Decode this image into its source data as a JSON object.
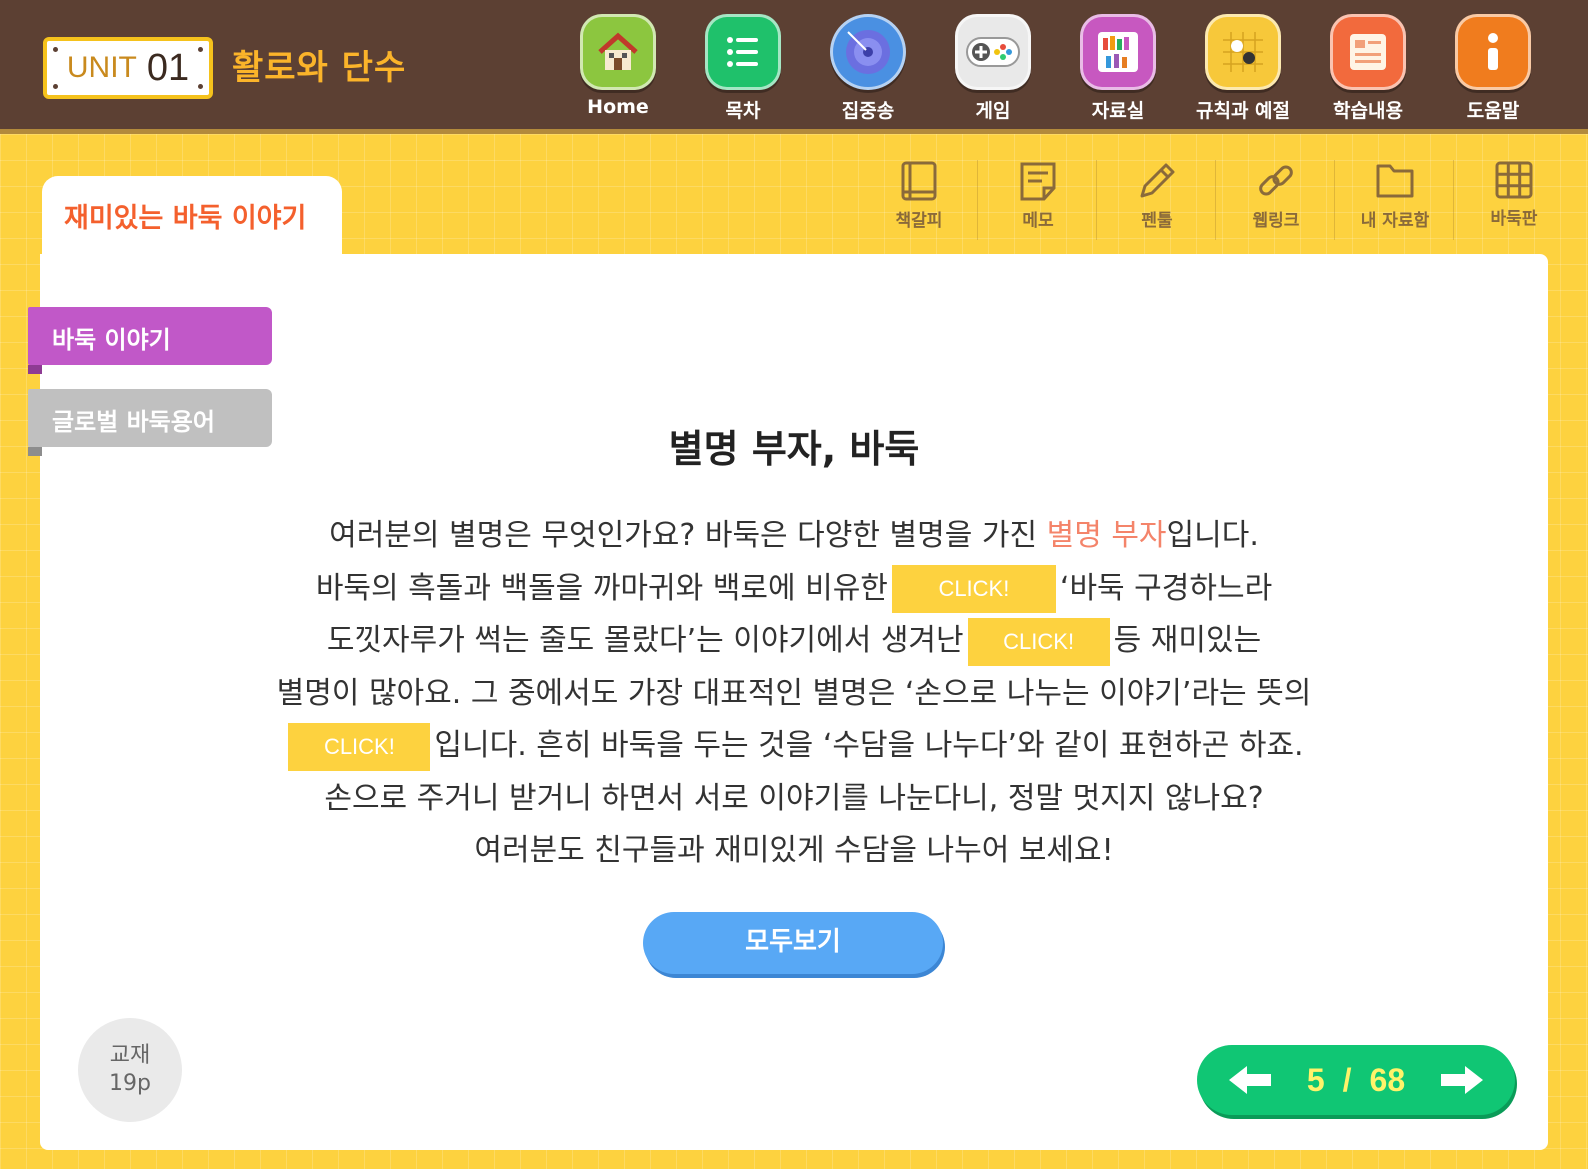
{
  "header": {
    "unit_word": "UNIT",
    "unit_number": "01",
    "unit_title": "활로와 단수",
    "nav": [
      {
        "label": "Home",
        "icon": "home-icon",
        "color": "#8cc63f"
      },
      {
        "label": "목차",
        "icon": "list-icon",
        "color": "#1fc16b"
      },
      {
        "label": "집중송",
        "icon": "disc-icon",
        "color": "#4a90e2"
      },
      {
        "label": "게임",
        "icon": "gamepad-icon",
        "color": "#e9e9e9"
      },
      {
        "label": "자료실",
        "icon": "bookshelf-icon",
        "color": "#c758c0"
      },
      {
        "label": "규칙과 예절",
        "icon": "go-board-icon",
        "color": "#f7c83a"
      },
      {
        "label": "학습내용",
        "icon": "notepad-icon",
        "color": "#f26a3d"
      },
      {
        "label": "도움말",
        "icon": "info-icon",
        "color": "#f07c1e"
      }
    ]
  },
  "tools": [
    {
      "label": "책갈피",
      "icon": "bookmark-icon"
    },
    {
      "label": "메모",
      "icon": "memo-icon"
    },
    {
      "label": "펜툴",
      "icon": "pen-icon"
    },
    {
      "label": "웹링크",
      "icon": "link-icon"
    },
    {
      "label": "내 자료함",
      "icon": "folder-icon"
    },
    {
      "label": "바둑판",
      "icon": "grid-icon"
    }
  ],
  "tab": {
    "label": "재미있는 바둑 이야기"
  },
  "side_menu": [
    {
      "label": "바둑 이야기",
      "active": true
    },
    {
      "label": "글로벌 바둑용어",
      "active": false
    }
  ],
  "content": {
    "heading": "별명 부자, 바둑",
    "line1_a": "여러분의 별명은 무엇인가요? 바둑은 다양한 별명을 가진 ",
    "line1_highlight": "별명 부자",
    "line1_b": "입니다.",
    "line2_a": "바둑의 흑돌과 백돌을 까마귀와 백로에 비유한",
    "line2_b": "‘바둑 구경하느라",
    "line3_a": "도낏자루가 썩는 줄도 몰랐다’는 이야기에서 생겨난",
    "line3_b": "등 재미있는",
    "line4": "별명이 많아요. 그 중에서도 가장 대표적인 별명은 ‘손으로 나누는 이야기’라는 뜻의",
    "line5_b": "입니다. 흔히 바둑을 두는 것을 ‘수담을 나누다’와 같이 표현하곤 하죠.",
    "line6": "손으로 주거니 받거니 하면서 서로 이야기를 나눈다니, 정말 멋지지 않나요?",
    "line7": "여러분도 친구들과 재미있게 수담을 나누어 보세요!",
    "click_label": "CLICK!",
    "view_all": "모두보기"
  },
  "footer": {
    "page_ref_line1": "교재",
    "page_ref_line2": "19p",
    "current_page": "5",
    "separator": "/",
    "total_pages": "68"
  }
}
